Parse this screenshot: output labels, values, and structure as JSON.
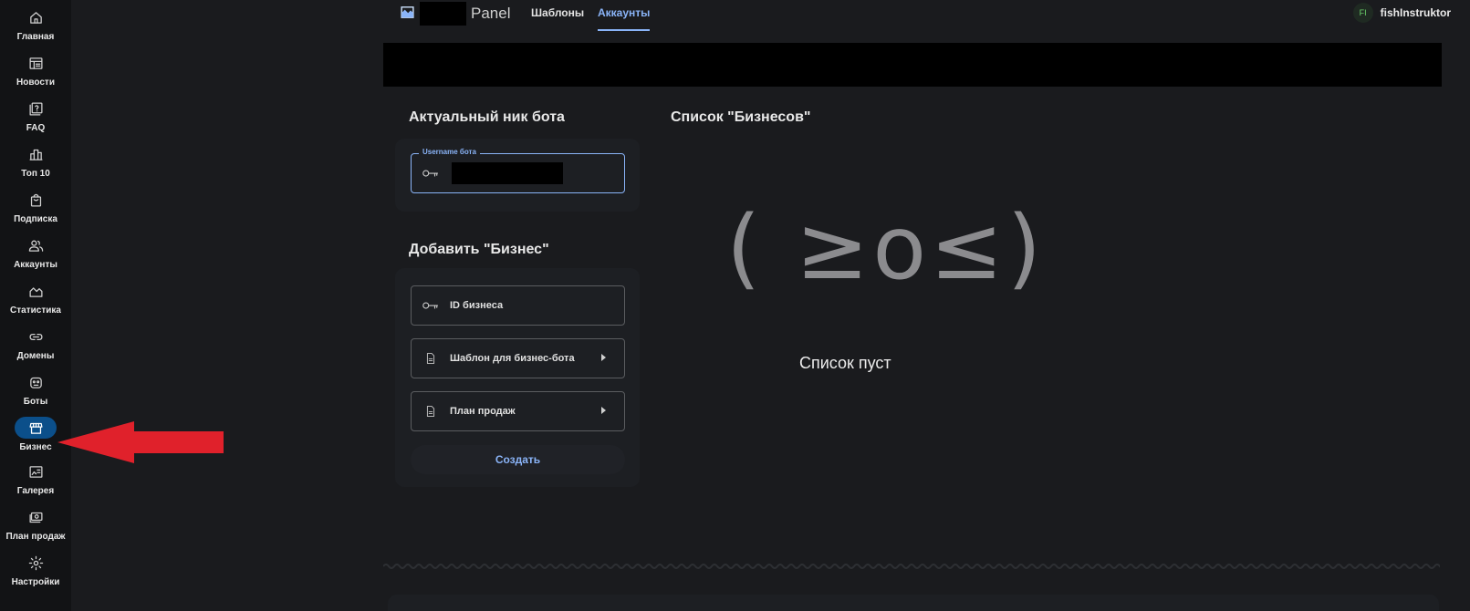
{
  "sidebar": {
    "items": [
      {
        "label": "Главная",
        "icon": "home-icon"
      },
      {
        "label": "Новости",
        "icon": "news-icon"
      },
      {
        "label": "FAQ",
        "icon": "faq-icon"
      },
      {
        "label": "Топ 10",
        "icon": "bar-chart-icon"
      },
      {
        "label": "Подписка",
        "icon": "shopping-bag-icon"
      },
      {
        "label": "Аккаунты",
        "icon": "users-icon"
      },
      {
        "label": "Статистика",
        "icon": "area-chart-icon"
      },
      {
        "label": "Домены",
        "icon": "link-icon"
      },
      {
        "label": "Боты",
        "icon": "bot-icon"
      },
      {
        "label": "Бизнес",
        "icon": "storefront-icon",
        "active": true
      },
      {
        "label": "Галерея",
        "icon": "gallery-icon"
      },
      {
        "label": "План продаж",
        "icon": "money-icon"
      },
      {
        "label": "Настройки",
        "icon": "gear-icon"
      }
    ]
  },
  "header": {
    "brand_suffix": "Panel",
    "tabs": [
      {
        "label": "Шаблоны"
      },
      {
        "label": "Аккаунты",
        "active": true
      }
    ],
    "user": {
      "initials": "FI",
      "name": "fishInstruktor"
    }
  },
  "bot_section": {
    "title": "Актуальный ник бота",
    "username_legend": "Username бота"
  },
  "business_form": {
    "title": "Добавить \"Бизнес\"",
    "id_placeholder": "ID бизнеса",
    "template_label": "Шаблон для бизнес-бота",
    "sales_plan_label": "План продаж",
    "create_label": "Создать"
  },
  "business_list": {
    "title": "Список \"Бизнесов\"",
    "empty_kaomoji": "( ≥o≤)",
    "empty_text": "Список пуст"
  },
  "colors": {
    "accent": "#8ab4f8",
    "active_nav": "#0b4f8a",
    "arrow": "#e0212b"
  }
}
